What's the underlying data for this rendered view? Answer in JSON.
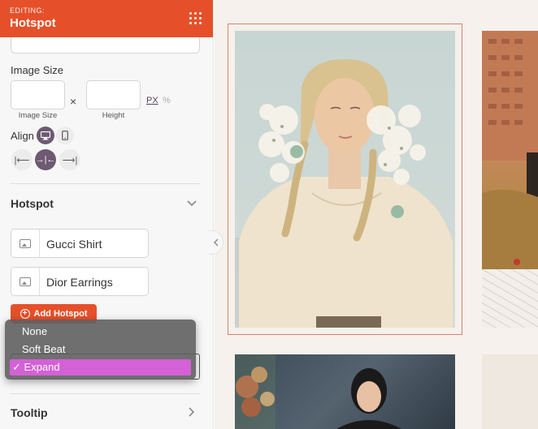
{
  "header": {
    "editing_label": "EDITING:",
    "title": "Hotspot",
    "menu_icon": "grid-dots-icon"
  },
  "image_size": {
    "label": "Image Size",
    "width_value": "",
    "width_caption": "Image Size",
    "separator": "×",
    "height_value": "",
    "height_caption": "Height",
    "unit_px": "PX",
    "unit_pct": "%"
  },
  "align": {
    "label": "Align",
    "devices": [
      "desktop-icon",
      "mobile-icon"
    ],
    "options": [
      "align-left-icon",
      "align-center-icon",
      "align-right-icon"
    ],
    "selected": "align-center-icon"
  },
  "hotspot_section": {
    "title": "Hotspot",
    "items": [
      {
        "label": "Gucci Shirt",
        "icon": "image-icon"
      },
      {
        "label": "Dior Earrings",
        "icon": "image-icon"
      }
    ],
    "add_button": "Add Hotspot"
  },
  "animation_dropdown": {
    "options": [
      "None",
      "Soft Beat",
      "Expand"
    ],
    "selected": "Expand",
    "check": "✓"
  },
  "tooltip_section": {
    "title": "Tooltip"
  },
  "colors": {
    "accent": "#e5502a",
    "selected_option": "#d461d6",
    "hotspot_marker": "#8fb59d"
  }
}
